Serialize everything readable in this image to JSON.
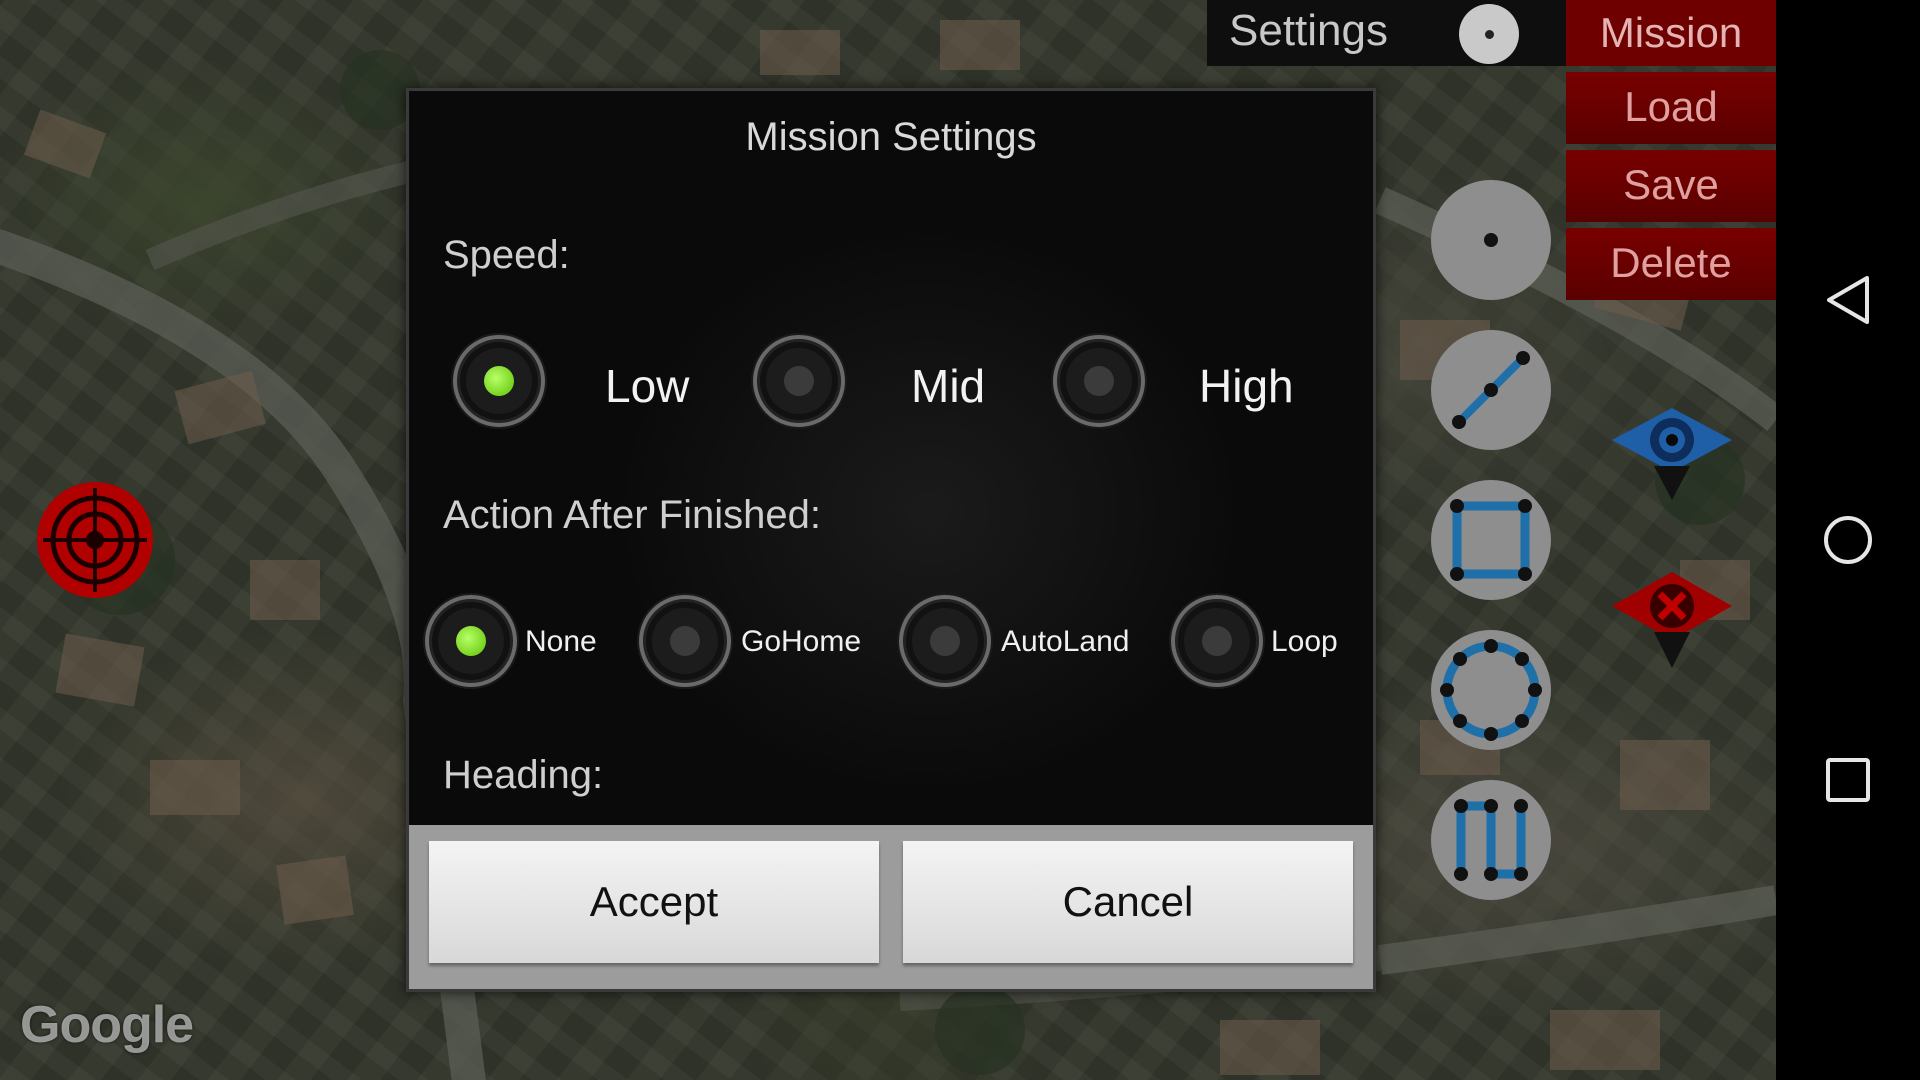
{
  "map": {
    "attribution": "Google"
  },
  "top_bar": {
    "settings_label": "Settings"
  },
  "mission_menu": {
    "items": [
      "Mission",
      "Load",
      "Save",
      "Delete"
    ]
  },
  "tools": [
    {
      "icon": "waypoint-dot-icon"
    },
    {
      "icon": "line-path-icon"
    },
    {
      "icon": "square-path-icon"
    },
    {
      "icon": "circle-path-icon"
    },
    {
      "icon": "grid-scan-path-icon"
    }
  ],
  "colors": {
    "accent_red": "#780000",
    "radio_selected": "#8be12a",
    "tool_blue": "#1f6fa8",
    "target_red": "#b00000"
  },
  "dialog": {
    "title": "Mission Settings",
    "speed": {
      "label": "Speed:",
      "options": [
        {
          "label": "Low",
          "checked": true
        },
        {
          "label": "Mid",
          "checked": false
        },
        {
          "label": "High",
          "checked": false
        }
      ]
    },
    "action": {
      "label": "Action After Finished:",
      "options": [
        {
          "label": "None",
          "checked": true
        },
        {
          "label": "GoHome",
          "checked": false
        },
        {
          "label": "AutoLand",
          "checked": false
        },
        {
          "label": "Loop",
          "checked": false
        }
      ]
    },
    "heading": {
      "label": "Heading:"
    },
    "accept_label": "Accept",
    "cancel_label": "Cancel"
  }
}
